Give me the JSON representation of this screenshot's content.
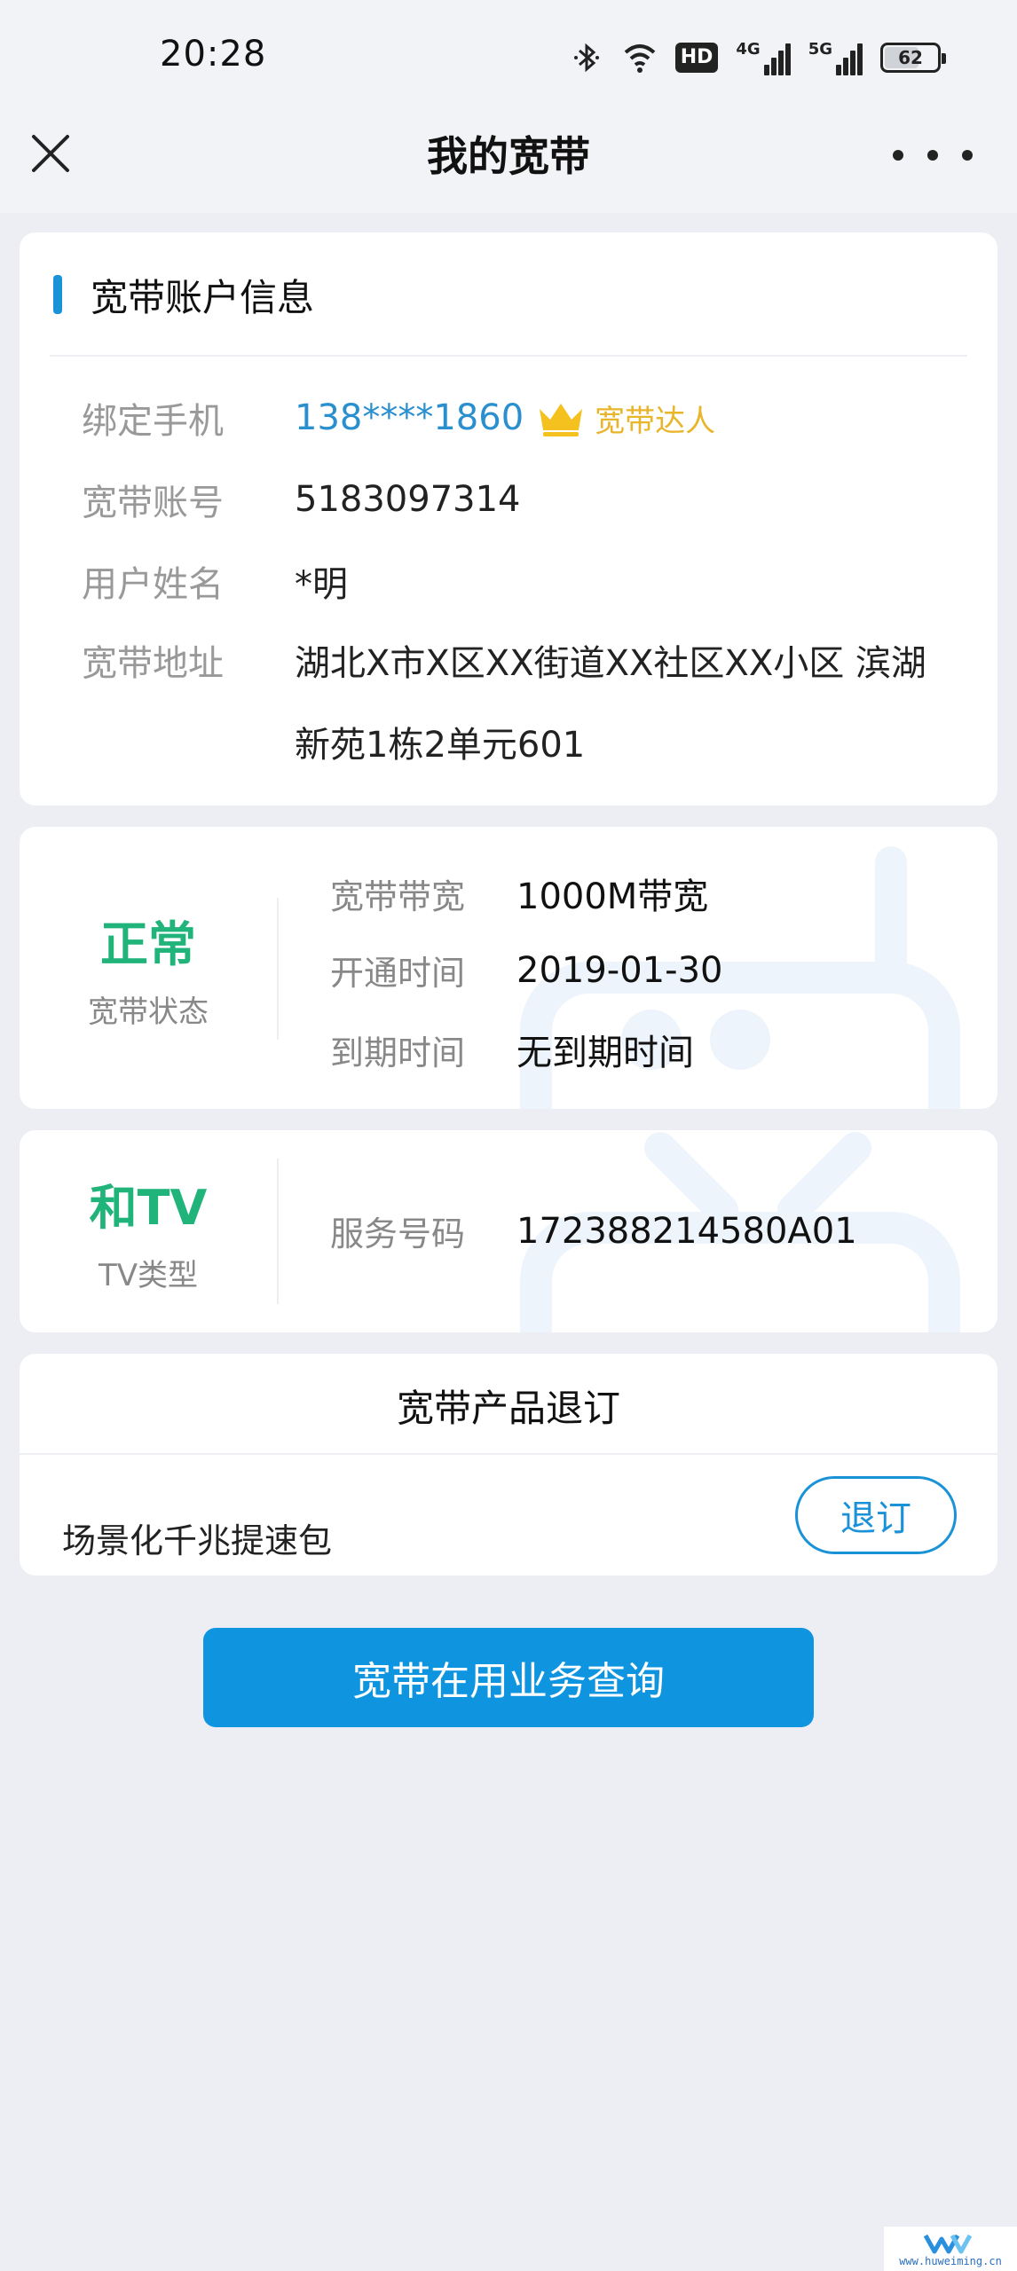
{
  "status_bar": {
    "time": "20:28",
    "hd_label": "HD",
    "net1_label": "4G",
    "net2_label": "5G",
    "battery": "62"
  },
  "header": {
    "title": "我的宽带",
    "close_icon": "close-icon",
    "more_icon": "more-icon"
  },
  "account": {
    "section_title": "宽带账户信息",
    "rows": [
      {
        "label": "绑定手机",
        "value": "138****1860"
      },
      {
        "label": "宽带账号",
        "value": "5183097314"
      },
      {
        "label": "用户姓名",
        "value": "*明"
      },
      {
        "label": "宽带地址",
        "value": "湖北X市X区XX街道XX社区XX小区 滨湖新苑1栋2单元601"
      }
    ],
    "vip_badge": "宽带达人",
    "accent_color": "#1a92d8"
  },
  "broadband_status": {
    "status": "正常",
    "status_label": "宽带状态",
    "status_color": "#20b37a",
    "details": [
      {
        "label": "宽带带宽",
        "value": "1000M带宽"
      },
      {
        "label": "开通时间",
        "value": "2019-01-30"
      },
      {
        "label": "到期时间",
        "value": "无到期时间"
      }
    ]
  },
  "tv": {
    "type": "和TV",
    "type_label": "TV类型",
    "service_label": "服务号码",
    "service_value": "172388214580A01"
  },
  "unsubscribe": {
    "title": "宽带产品退订",
    "product": "场景化千兆提速包",
    "button": "退订"
  },
  "query_button": "宽带在用业务查询",
  "watermark": "www.huweiming.cn"
}
